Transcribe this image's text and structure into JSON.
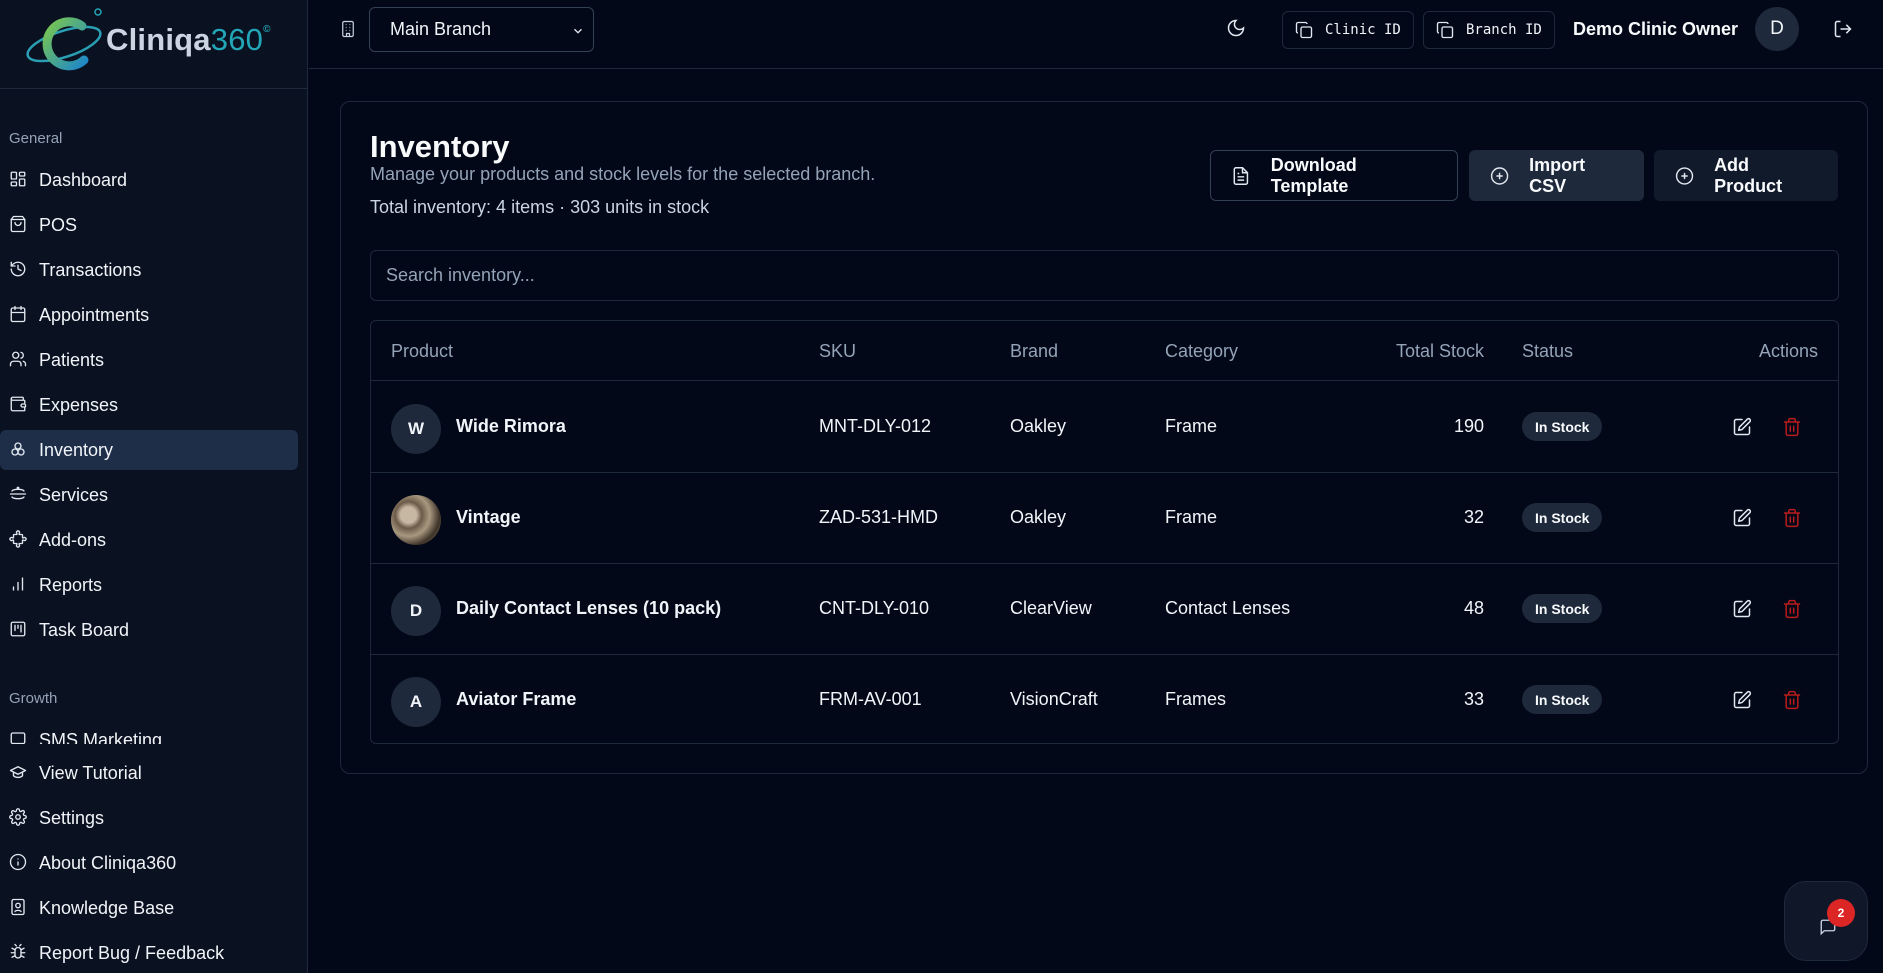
{
  "brand": {
    "name_main": "Cliniqa",
    "name_num": "360",
    "name_sup": "©"
  },
  "sidebar": {
    "general_label": "General",
    "items": [
      {
        "label": "Dashboard",
        "icon": "dashboard-icon"
      },
      {
        "label": "POS",
        "icon": "shopping-bag-icon"
      },
      {
        "label": "Transactions",
        "icon": "history-icon"
      },
      {
        "label": "Appointments",
        "icon": "calendar-icon"
      },
      {
        "label": "Patients",
        "icon": "users-icon"
      },
      {
        "label": "Expenses",
        "icon": "wallet-icon"
      },
      {
        "label": "Inventory",
        "icon": "boxes-icon",
        "active": true
      },
      {
        "label": "Services",
        "icon": "services-icon"
      },
      {
        "label": "Add-ons",
        "icon": "puzzle-icon"
      },
      {
        "label": "Reports",
        "icon": "bar-chart-icon"
      },
      {
        "label": "Task Board",
        "icon": "kanban-icon"
      }
    ],
    "growth_label": "Growth",
    "growth_items": [
      {
        "label": "SMS Marketing",
        "icon": "message-icon"
      }
    ],
    "bottom_items": [
      {
        "label": "View Tutorial",
        "icon": "graduation-cap-icon"
      },
      {
        "label": "Settings",
        "icon": "gear-icon"
      },
      {
        "label": "About Cliniqa360",
        "icon": "info-icon"
      },
      {
        "label": "Knowledge Base",
        "icon": "book-icon"
      },
      {
        "label": "Report Bug / Feedback",
        "icon": "bug-icon"
      }
    ]
  },
  "topbar": {
    "branch_selected": "Main Branch",
    "clinic_id_label": "Clinic ID",
    "branch_id_label": "Branch ID",
    "owner_name": "Demo Clinic Owner",
    "avatar_initial": "D"
  },
  "page": {
    "title": "Inventory",
    "subtitle": "Manage your products and stock levels for the selected branch.",
    "total": "Total inventory: 4 items · 303 units in stock",
    "buttons": {
      "download_template": "Download Template",
      "import_csv": "Import CSV",
      "add_product": "Add Product"
    },
    "search_placeholder": "Search inventory..."
  },
  "table": {
    "headers": {
      "product": "Product",
      "sku": "SKU",
      "brand": "Brand",
      "category": "Category",
      "total_stock": "Total Stock",
      "status": "Status",
      "actions": "Actions"
    },
    "rows": [
      {
        "initial": "W",
        "product": "Wide Rimora",
        "sku": "MNT-DLY-012",
        "brand": "Oakley",
        "category": "Frame",
        "stock": "190",
        "status": "In Stock"
      },
      {
        "initial": "",
        "product": "Vintage",
        "sku": "ZAD-531-HMD",
        "brand": "Oakley",
        "category": "Frame",
        "stock": "32",
        "status": "In Stock"
      },
      {
        "initial": "D",
        "product": "Daily Contact Lenses (10 pack)",
        "sku": "CNT-DLY-010",
        "brand": "ClearView",
        "category": "Contact Lenses",
        "stock": "48",
        "status": "In Stock"
      },
      {
        "initial": "A",
        "product": "Aviator Frame",
        "sku": "FRM-AV-001",
        "brand": "VisionCraft",
        "category": "Frames",
        "stock": "33",
        "status": "In Stock"
      }
    ]
  },
  "chat": {
    "notification_count": "2"
  },
  "colors": {
    "background": "#020817",
    "sidebar": "#0a1120",
    "active": "#1e2d48",
    "danger": "#b91c1c",
    "badge": "#dc2626"
  }
}
